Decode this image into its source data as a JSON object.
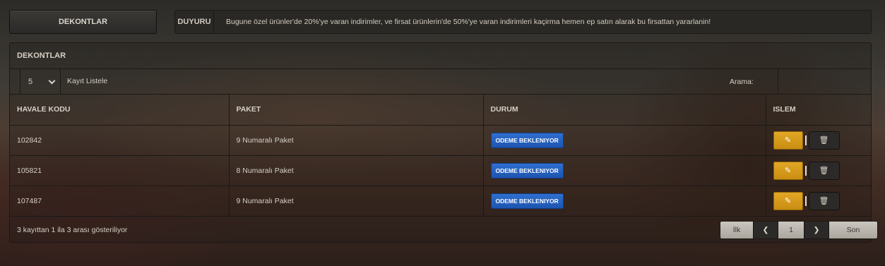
{
  "top": {
    "tab_label": "DEKONTLAR",
    "notice_label": "DUYURU",
    "notice_text": "Bugune özel ürünler'de 20%'ye varan indirimler, ve firsat ürünlerin'de 50%'ye varan indirimleri kaçirma hemen ep satın alarak bu firsattan yararlanin!"
  },
  "panel": {
    "title": "DEKONTLAR",
    "length_value": "5",
    "length_label": "Kayıt Listele",
    "search_label": "Arama:",
    "search_value": ""
  },
  "table": {
    "headers": [
      "HAVALE KODU",
      "PAKET",
      "DURUM",
      "ISLEM"
    ],
    "rows": [
      {
        "code": "102842",
        "package": "9 Numaralı Paket",
        "status": "ODEME BEKLENIYOR"
      },
      {
        "code": "105821",
        "package": "8 Numaralı Paket",
        "status": "ODEME BEKLENIYOR"
      },
      {
        "code": "107487",
        "package": "9 Numaralı Paket",
        "status": "ODEME BEKLENIYOR"
      }
    ]
  },
  "footer": {
    "info": "3 kayıttan 1 ila 3 arası gösteriliyor",
    "first": "İlk",
    "page": "1",
    "last": "Son"
  },
  "colors": {
    "status_badge": "#2563c4",
    "edit_button": "#d99d1c",
    "delete_button": "#2c2a28"
  },
  "icons": {
    "edit": "pencil-square-icon",
    "delete": "trash-icon",
    "prev": "chevron-left-icon",
    "next": "chevron-right-icon"
  }
}
